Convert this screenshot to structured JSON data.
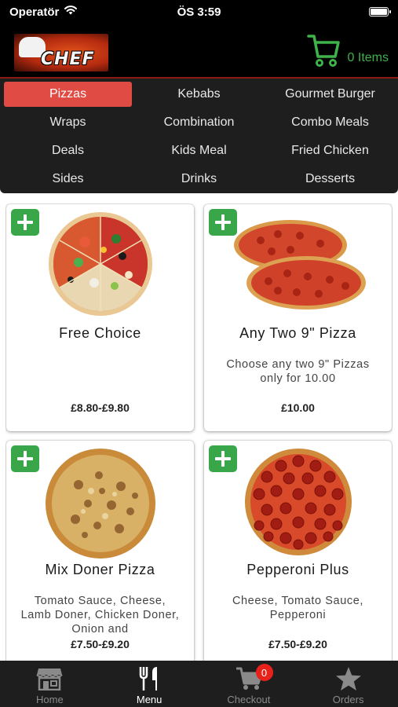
{
  "status_bar": {
    "carrier": "Operatör",
    "time": "ÖS 3:59"
  },
  "header": {
    "logo_text": "CHEF",
    "cart_label": "0 Items"
  },
  "categories": [
    {
      "label": "Pizzas",
      "active": true
    },
    {
      "label": "Kebabs",
      "active": false
    },
    {
      "label": "Gourmet Burger",
      "active": false
    },
    {
      "label": "Wraps",
      "active": false
    },
    {
      "label": "Combination",
      "active": false
    },
    {
      "label": "Combo Meals",
      "active": false
    },
    {
      "label": "Deals",
      "active": false
    },
    {
      "label": "Kids Meal",
      "active": false
    },
    {
      "label": "Fried Chicken",
      "active": false
    },
    {
      "label": "Sides",
      "active": false
    },
    {
      "label": "Drinks",
      "active": false
    },
    {
      "label": "Desserts",
      "active": false
    }
  ],
  "products": [
    {
      "name": "Free Choice",
      "description": "",
      "price": "£8.80-£9.80",
      "image": "mixed-pizza"
    },
    {
      "name": "Any Two 9\" Pizza",
      "description": "Choose any two 9\" Pizzas only for 10.00",
      "price": "£10.00",
      "image": "two-pizzas"
    },
    {
      "name": "Mix Doner Pizza",
      "description": "Tomato Sauce, Cheese, Lamb Doner, Chicken Doner, Onion and",
      "price": "£7.50-£9.20",
      "image": "doner-pizza"
    },
    {
      "name": "Pepperoni Plus",
      "description": "Cheese, Tomato Sauce, Pepperoni",
      "price": "£7.50-£9.20",
      "image": "pepperoni-pizza"
    }
  ],
  "tabs": [
    {
      "label": "Home",
      "icon": "storefront-icon"
    },
    {
      "label": "Menu",
      "icon": "fork-knife-icon"
    },
    {
      "label": "Checkout",
      "icon": "cart-icon",
      "badge": "0"
    },
    {
      "label": "Orders",
      "icon": "star-icon"
    }
  ],
  "colors": {
    "accent_green": "#3aa64a",
    "active_category": "#e04b44",
    "badge_red": "#e8221b"
  }
}
